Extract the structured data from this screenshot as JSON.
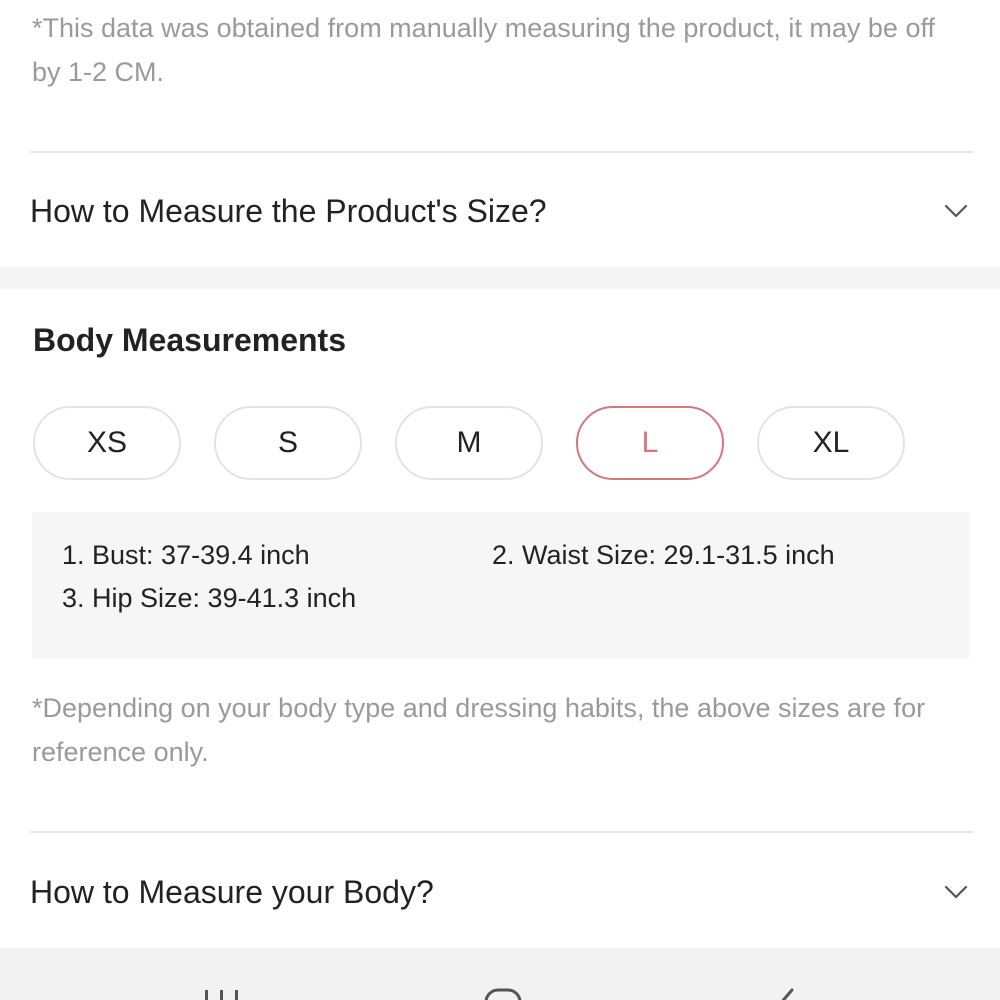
{
  "measurement_note": "*This data was obtained from manually measuring the product, it may be off by 1-2 CM.",
  "product_size_help": {
    "label": "How to Measure the Product's Size?",
    "icon": "chevron-down-icon"
  },
  "body_measurements": {
    "title": "Body Measurements",
    "sizes": [
      {
        "label": "XS",
        "selected": false
      },
      {
        "label": "S",
        "selected": false
      },
      {
        "label": "M",
        "selected": false
      },
      {
        "label": "L",
        "selected": true
      },
      {
        "label": "XL",
        "selected": false
      }
    ],
    "details": {
      "bust": "1. Bust: 37-39.4 inch",
      "waist": "2. Waist Size: 29.1-31.5 inch",
      "hip": "3. Hip Size: 39-41.3 inch"
    },
    "disclaimer": "*Depending on your body type and dressing habits, the above sizes are for reference only."
  },
  "body_size_help": {
    "label": "How to Measure your Body?",
    "icon": "chevron-down-icon"
  },
  "colors": {
    "accent": "#d9757c",
    "muted_text": "#9a9a9a",
    "divider": "#e6e6e6"
  },
  "nav_bar": {
    "icons": [
      "recent-apps-icon",
      "home-icon",
      "back-icon"
    ]
  }
}
